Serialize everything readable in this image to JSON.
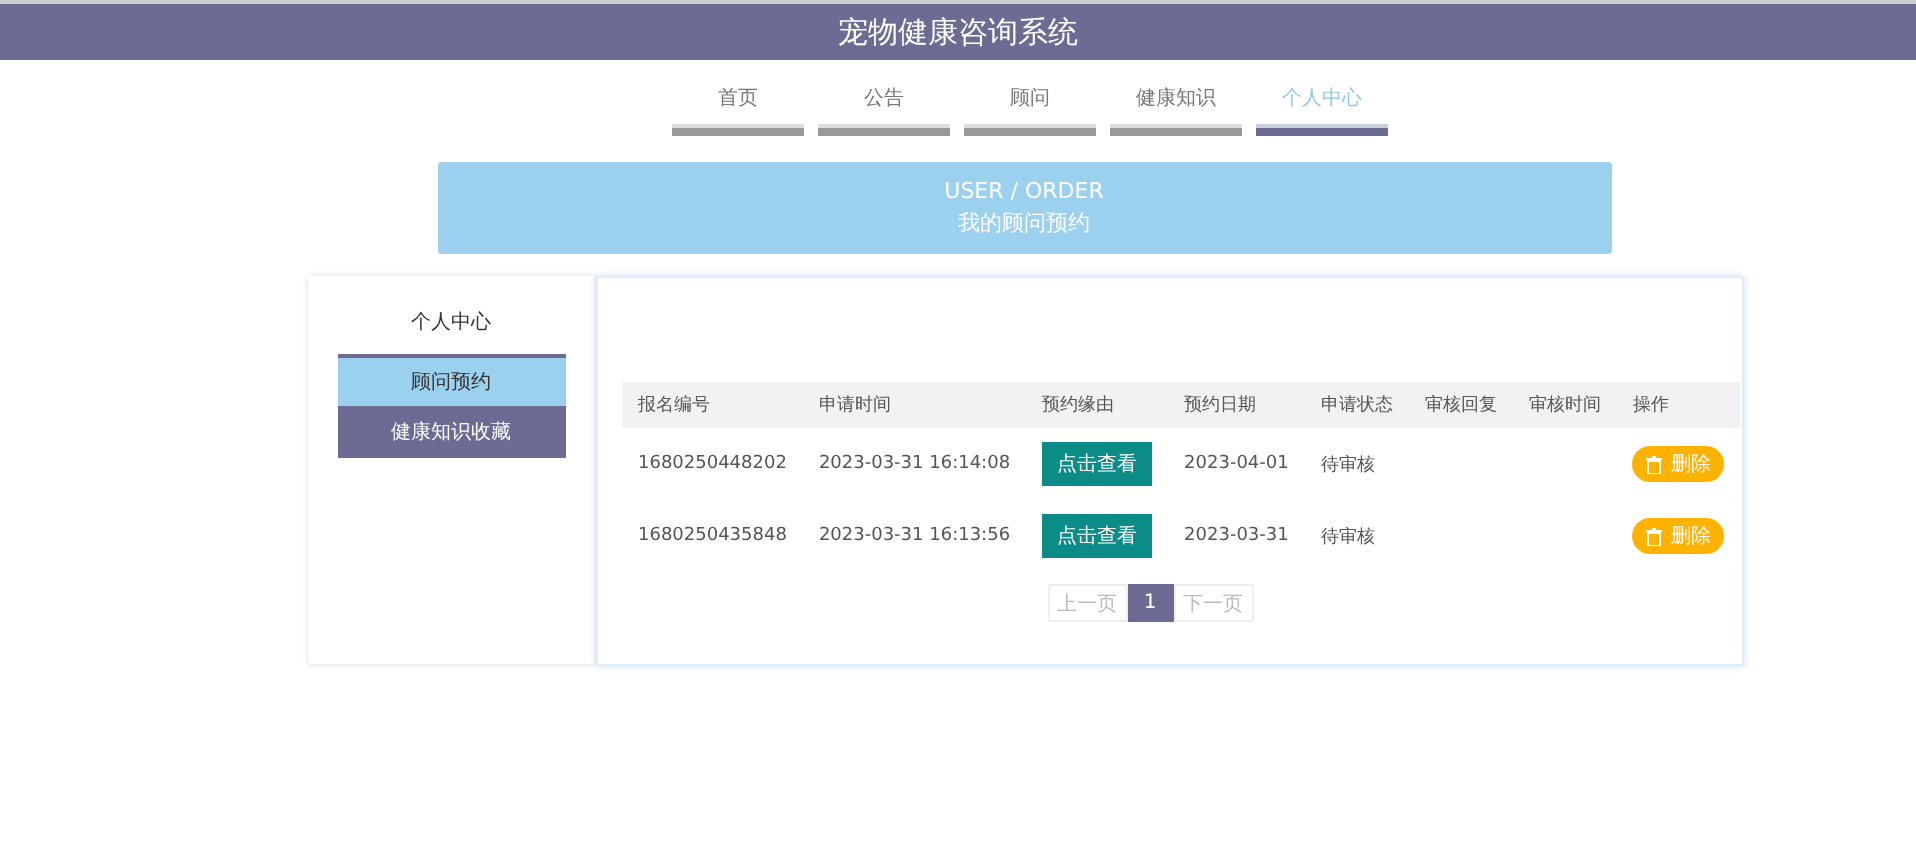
{
  "header": {
    "title": "宠物健康咨询系统"
  },
  "nav": [
    {
      "label": "首页",
      "selected": false
    },
    {
      "label": "公告",
      "selected": false
    },
    {
      "label": "顾问",
      "selected": false
    },
    {
      "label": "健康知识",
      "selected": false
    },
    {
      "label": "个人中心",
      "selected": true
    }
  ],
  "banner": {
    "subtitle": "USER / ORDER",
    "title": "我的顾问预约"
  },
  "sidebar": {
    "title": "个人中心",
    "items": [
      {
        "label": "顾问预约",
        "selected": true
      },
      {
        "label": "健康知识收藏",
        "selected": false
      }
    ]
  },
  "table": {
    "columns": [
      "报名编号",
      "申请时间",
      "预约缘由",
      "预约日期",
      "申请状态",
      "审核回复",
      "审核时间",
      "操作"
    ],
    "rows": [
      {
        "id": "1680250448202",
        "time": "2023-03-31 16:14:08",
        "reason_button": "点击查看",
        "date": "2023-04-01",
        "status": "待审核",
        "delete_button": "删除"
      },
      {
        "id": "1680250435848",
        "time": "2023-03-31 16:13:56",
        "reason_button": "点击查看",
        "date": "2023-03-31",
        "status": "待审核",
        "delete_button": "删除"
      }
    ]
  },
  "pagination": {
    "prev": "上一页",
    "pages": [
      {
        "label": "1",
        "selected": true
      }
    ],
    "next": "下一页"
  }
}
